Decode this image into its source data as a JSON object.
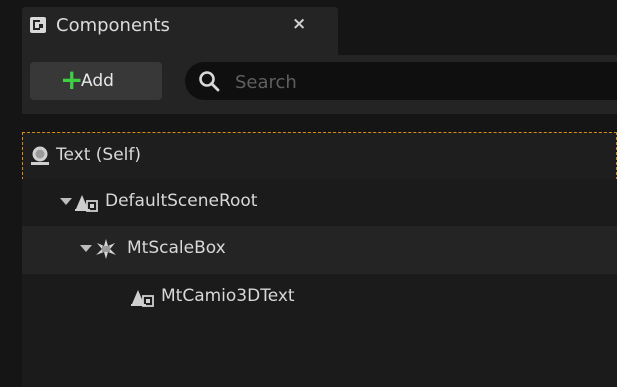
{
  "tab": {
    "title": "Components",
    "close": "×"
  },
  "toolbar": {
    "add_label": "Add",
    "add_plus": "+",
    "search_placeholder": "Search",
    "search_value": ""
  },
  "tree": {
    "items": [
      {
        "label": "Text (Self)",
        "icon": "self-actor-icon",
        "selected": true
      },
      {
        "label": "DefaultSceneRoot",
        "icon": "scene-component-icon",
        "expanded": true
      },
      {
        "label": "MtScaleBox",
        "icon": "scale-box-icon",
        "expanded": true
      },
      {
        "label": "MtCamio3DText",
        "icon": "scene-component-icon"
      }
    ]
  },
  "colors": {
    "accent_plus": "#3fcf45",
    "selection_outline": "#d98b12",
    "scale_icon": "#d6d6d6"
  }
}
